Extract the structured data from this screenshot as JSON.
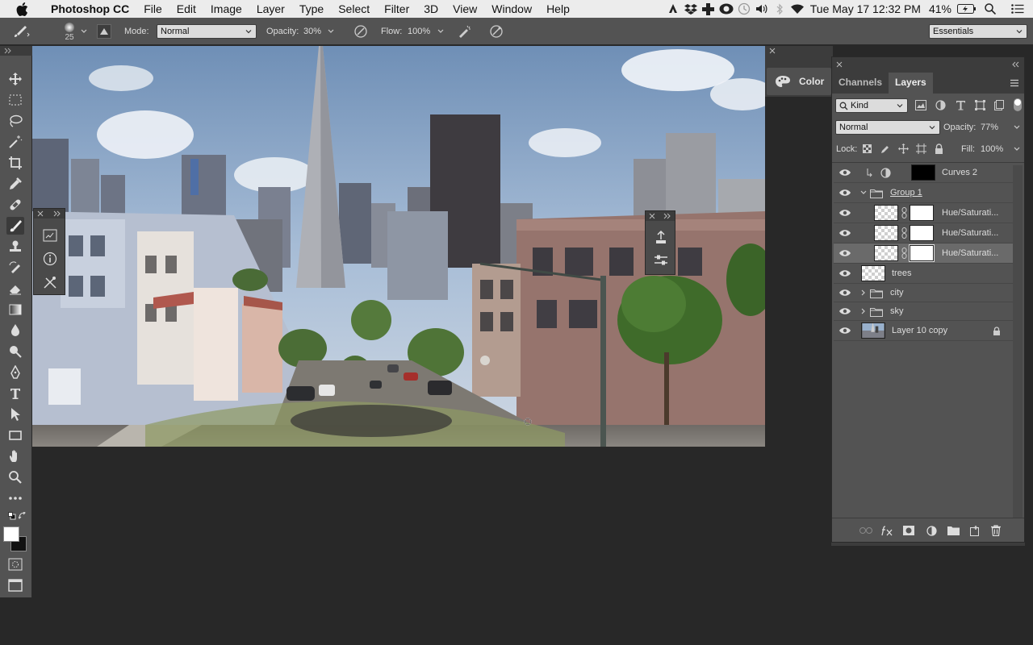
{
  "menubar": {
    "app_name": "Photoshop CC",
    "items": [
      "File",
      "Edit",
      "Image",
      "Layer",
      "Type",
      "Select",
      "Filter",
      "3D",
      "View",
      "Window",
      "Help"
    ],
    "clock": "Tue May 17  12:32 PM",
    "battery": "41%"
  },
  "options": {
    "brush_size": "25",
    "mode_label": "Mode:",
    "mode_value": "Normal",
    "opacity_label": "Opacity:",
    "opacity_value": "30%",
    "flow_label": "Flow:",
    "flow_value": "100%",
    "workspace": "Essentials"
  },
  "color_panel": {
    "label": "Color"
  },
  "layers_panel": {
    "tabs": [
      "Channels",
      "Layers"
    ],
    "active_tab": "Layers",
    "filter_kind": "Kind",
    "blend_mode": "Normal",
    "opacity_label": "Opacity:",
    "opacity_value": "77%",
    "lock_label": "Lock:",
    "fill_label": "Fill:",
    "fill_value": "100%",
    "layers": [
      {
        "name": "Curves 2"
      },
      {
        "name": "Group 1"
      },
      {
        "name": "Hue/Saturati..."
      },
      {
        "name": "Hue/Saturati..."
      },
      {
        "name": "Hue/Saturati..."
      },
      {
        "name": "trees"
      },
      {
        "name": "city"
      },
      {
        "name": "sky"
      },
      {
        "name": "Layer 10 copy"
      }
    ]
  },
  "colors": {
    "panel_bg": "#535353",
    "dark_bg": "#282828",
    "menubar_bg": "#ececec",
    "selected_row": "#6a6a6a"
  }
}
